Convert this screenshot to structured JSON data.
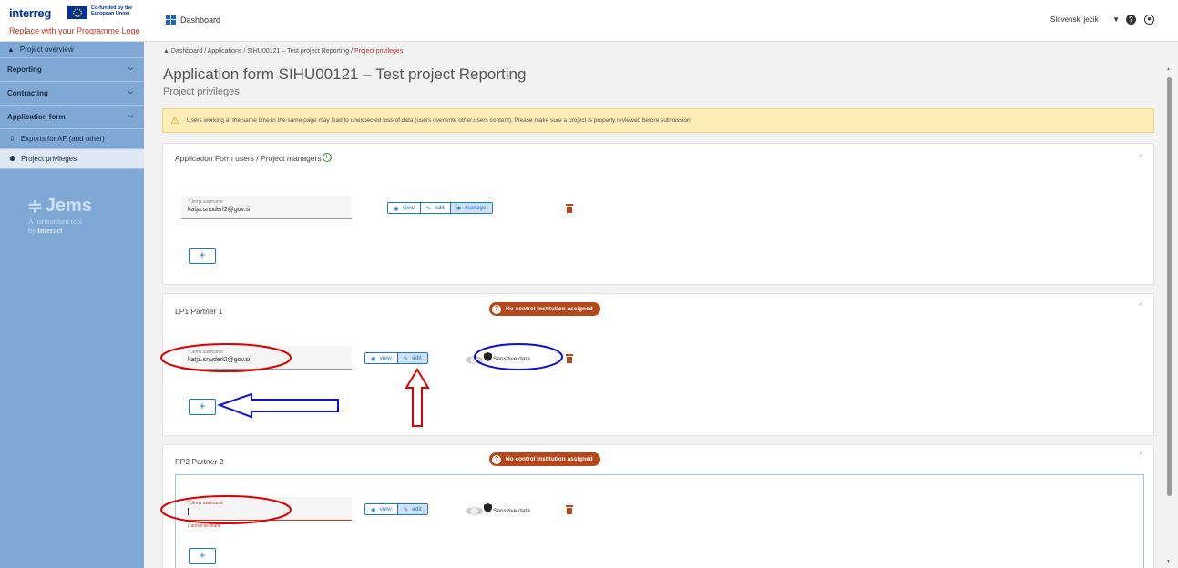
{
  "header": {
    "programme_name": "interreg",
    "cofunded_text": "Co-funded by the European Union",
    "logo_placeholder": "Replace with your Programme Logo",
    "dashboard_label": "Dashboard",
    "language": "Slovenski jezik"
  },
  "sidebar": {
    "items": [
      {
        "label": "Project overview"
      },
      {
        "label": "Reporting"
      },
      {
        "label": "Contracting"
      },
      {
        "label": "Application form"
      },
      {
        "label": "Exports for AF (and other)"
      },
      {
        "label": "Project privileges"
      }
    ],
    "brand": "Jems",
    "tagline_1": "A harmonised tool",
    "tagline_2_prefix": "by",
    "tagline_2_brand": "Interact"
  },
  "breadcrumb": {
    "items": [
      "Dashboard",
      "Applications",
      "SIHU00121 – Test project Reporting"
    ],
    "current": "Project privileges",
    "separator": "/"
  },
  "page": {
    "title": "Application form SIHU00121 – Test project Reporting",
    "subtitle": "Project privileges",
    "warning": "Users working at the same time in the same page may lead to unexpected loss of data (users overwrite other users content). Please make sure a project is properly reviewed before submission."
  },
  "sections": {
    "managers": {
      "title": "Application Form users / Project managers",
      "username_label": "* Jems username",
      "username_value": "katja.snuderl2@gov.si",
      "perm_view": "view",
      "perm_edit": "edit",
      "perm_manage": "manage",
      "selected_permission": "manage"
    },
    "lp1": {
      "title": "LP1 Partner 1",
      "badge": "No control institution assigned",
      "username_label": "* Jems username",
      "username_value": "katja.snuderl2@gov.si",
      "perm_view": "view",
      "perm_edit": "edit",
      "selected_permission": "edit",
      "sensitive_label": "Sensitive data",
      "sensitive_on": false
    },
    "pp2": {
      "title": "PP2 Partner 2",
      "badge": "No control institution assigned",
      "username_label": "* Jems username",
      "username_value": "",
      "error": "Cannot be blank",
      "perm_view": "view",
      "perm_edit": "edit",
      "selected_permission": "edit",
      "sensitive_label": "Sensitive data",
      "sensitive_on": false
    },
    "add_label": "+"
  },
  "colors": {
    "sidebar_bg": "#7fa9d4",
    "accent": "#1976d2",
    "danger": "#b5471b",
    "annotation_red": "#e00000",
    "annotation_blue": "#1010d0"
  }
}
